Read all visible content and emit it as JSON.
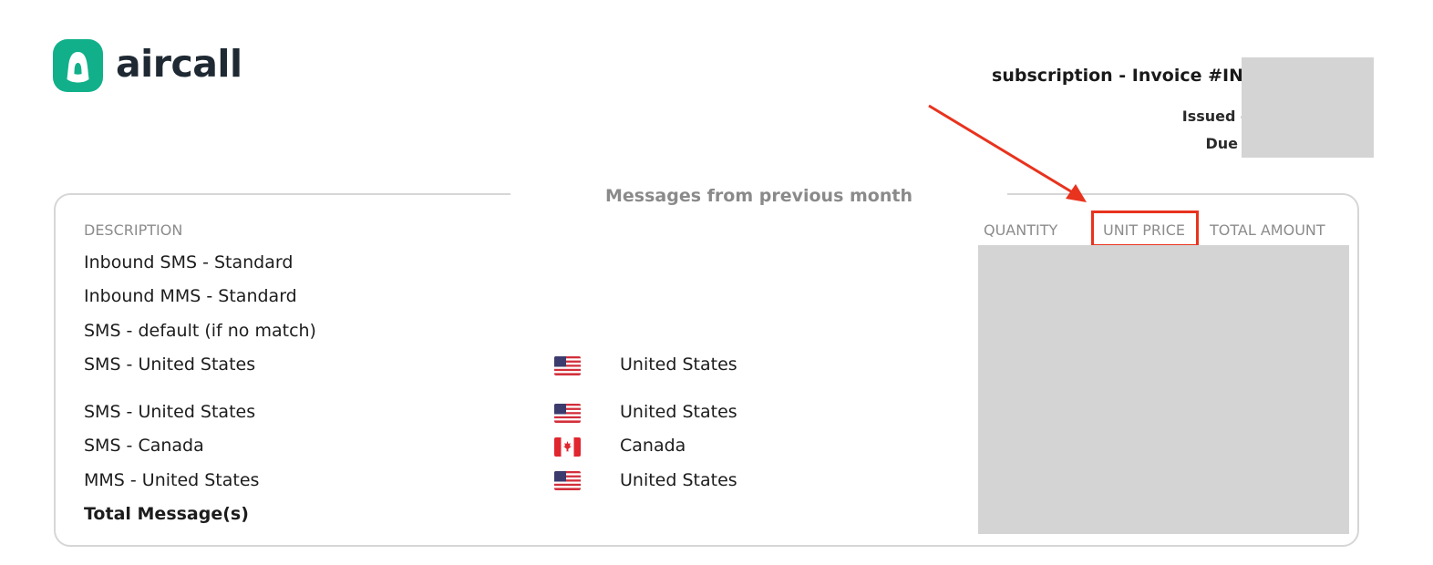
{
  "brand": {
    "name": "aircall",
    "color": "#11b08a"
  },
  "invoice": {
    "title": "subscription - Invoice #IN",
    "issued_label": "Issued o",
    "due_label": "Due"
  },
  "section": {
    "title": "Messages from previous month",
    "columns": {
      "description": "DESCRIPTION",
      "quantity": "QUANTITY",
      "unit_price": "UNIT PRICE",
      "total_amount": "TOTAL AMOUNT"
    },
    "rows": [
      {
        "description": "Inbound SMS - Standard",
        "country": "",
        "flag": ""
      },
      {
        "description": "Inbound MMS - Standard",
        "country": "",
        "flag": ""
      },
      {
        "description": "SMS - default (if no match)",
        "country": "",
        "flag": ""
      },
      {
        "description": "SMS - United States",
        "country": "United States",
        "flag": "us-flag-icon"
      },
      {
        "description": "SMS - United States",
        "country": "United States",
        "flag": "us-flag-icon"
      },
      {
        "description": "SMS - Canada",
        "country": "Canada",
        "flag": "canada-flag-icon"
      },
      {
        "description": "MMS - United States",
        "country": "United States",
        "flag": "us-flag-icon"
      }
    ],
    "total_label": "Total Message(s)"
  },
  "annotation": {
    "color": "#e8331e",
    "target": "unit-price-header"
  },
  "redaction_color": "#d4d4d4"
}
